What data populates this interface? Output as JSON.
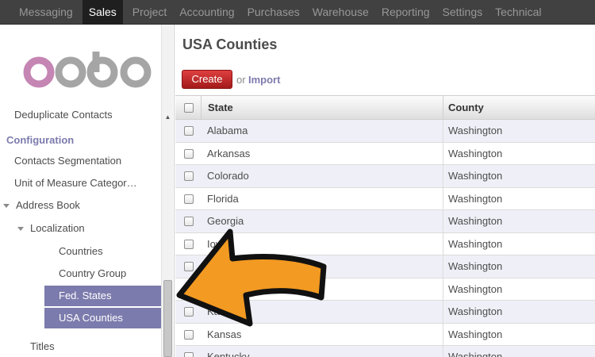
{
  "topbar": {
    "menu": [
      "Messaging",
      "Sales",
      "Project",
      "Accounting",
      "Purchases",
      "Warehouse",
      "Reporting",
      "Settings",
      "Technical"
    ],
    "active": "Sales"
  },
  "sidebar": {
    "logo_text": "odoo",
    "items": {
      "deduplicate": "Deduplicate Contacts",
      "configuration": "Configuration",
      "contacts_segmentation": "Contacts Segmentation",
      "uom_categories": "Unit of Measure Categor…",
      "address_book": "Address Book",
      "localization": "Localization",
      "countries": "Countries",
      "country_group": "Country Group",
      "fed_states": "Fed. States",
      "usa_counties": "USA Counties",
      "titles": "Titles"
    }
  },
  "main": {
    "title": "USA Counties",
    "create_label": "Create",
    "or_label": "or",
    "import_label": "Import",
    "columns": {
      "state": "State",
      "county": "County"
    },
    "rows": [
      {
        "state": "Alabama",
        "county": "Washington"
      },
      {
        "state": "Arkansas",
        "county": "Washington"
      },
      {
        "state": "Colorado",
        "county": "Washington"
      },
      {
        "state": "Florida",
        "county": "Washington"
      },
      {
        "state": "Georgia",
        "county": "Washington"
      },
      {
        "state": "Iowa",
        "county": "Washington"
      },
      {
        "state": "",
        "county": "Washington"
      },
      {
        "state": "",
        "county": "Washington"
      },
      {
        "state": "Kansas",
        "county": "Washington"
      },
      {
        "state": "Kansas",
        "county": "Washington"
      },
      {
        "state": "Kentucky",
        "county": "Washington"
      }
    ]
  },
  "colors": {
    "topbar": "#414141",
    "accent": "#7c7bad",
    "create": "#c52626",
    "arrow": "#f39a22"
  }
}
